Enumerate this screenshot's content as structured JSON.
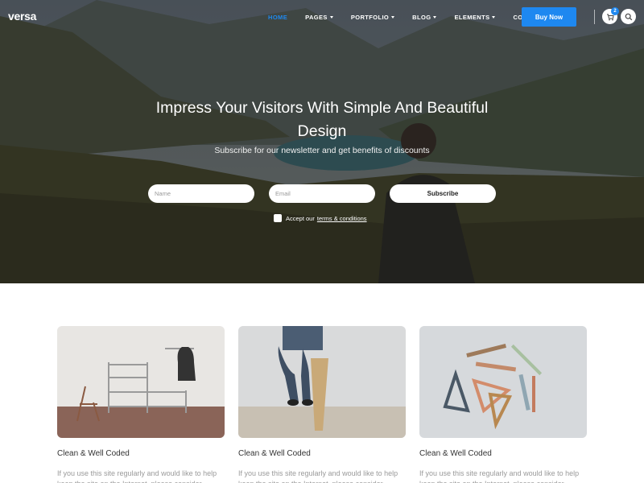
{
  "brand": {
    "logo": "versa"
  },
  "nav": {
    "items": [
      {
        "label": "HOME",
        "active": true,
        "dropdown": false
      },
      {
        "label": "PAGES",
        "active": false,
        "dropdown": true
      },
      {
        "label": "PORTFOLIO",
        "active": false,
        "dropdown": true
      },
      {
        "label": "BLOG",
        "active": false,
        "dropdown": true
      },
      {
        "label": "ELEMENTS",
        "active": false,
        "dropdown": true
      },
      {
        "label": "CONTACT",
        "active": false,
        "dropdown": true
      }
    ],
    "buy_label": "Buy Now",
    "cart_count": "2",
    "cart_icon": "cart-icon",
    "search_icon": "search-icon"
  },
  "hero": {
    "title": "Impress Your Visitors With Simple And Beautiful Design",
    "subtitle": "Subscribe for our newsletter and get benefits of discounts",
    "name_placeholder": "Name",
    "email_placeholder": "Email",
    "subscribe_label": "Subscribe",
    "accept_text": "Accept our",
    "terms_text": "terms & conditions"
  },
  "cards": [
    {
      "title": "Clean & Well Coded",
      "text": "If you use this site regularly and would like to help keep the site on the Internet, please consider"
    },
    {
      "title": "Clean & Well Coded",
      "text": "If you use this site regularly and would like to help keep the site on the Internet, please consider"
    },
    {
      "title": "Clean & Well Coded",
      "text": "If you use this site regularly and would like to help keep the site on the Internet, please consider"
    }
  ],
  "colors": {
    "accent": "#1e88f0"
  }
}
